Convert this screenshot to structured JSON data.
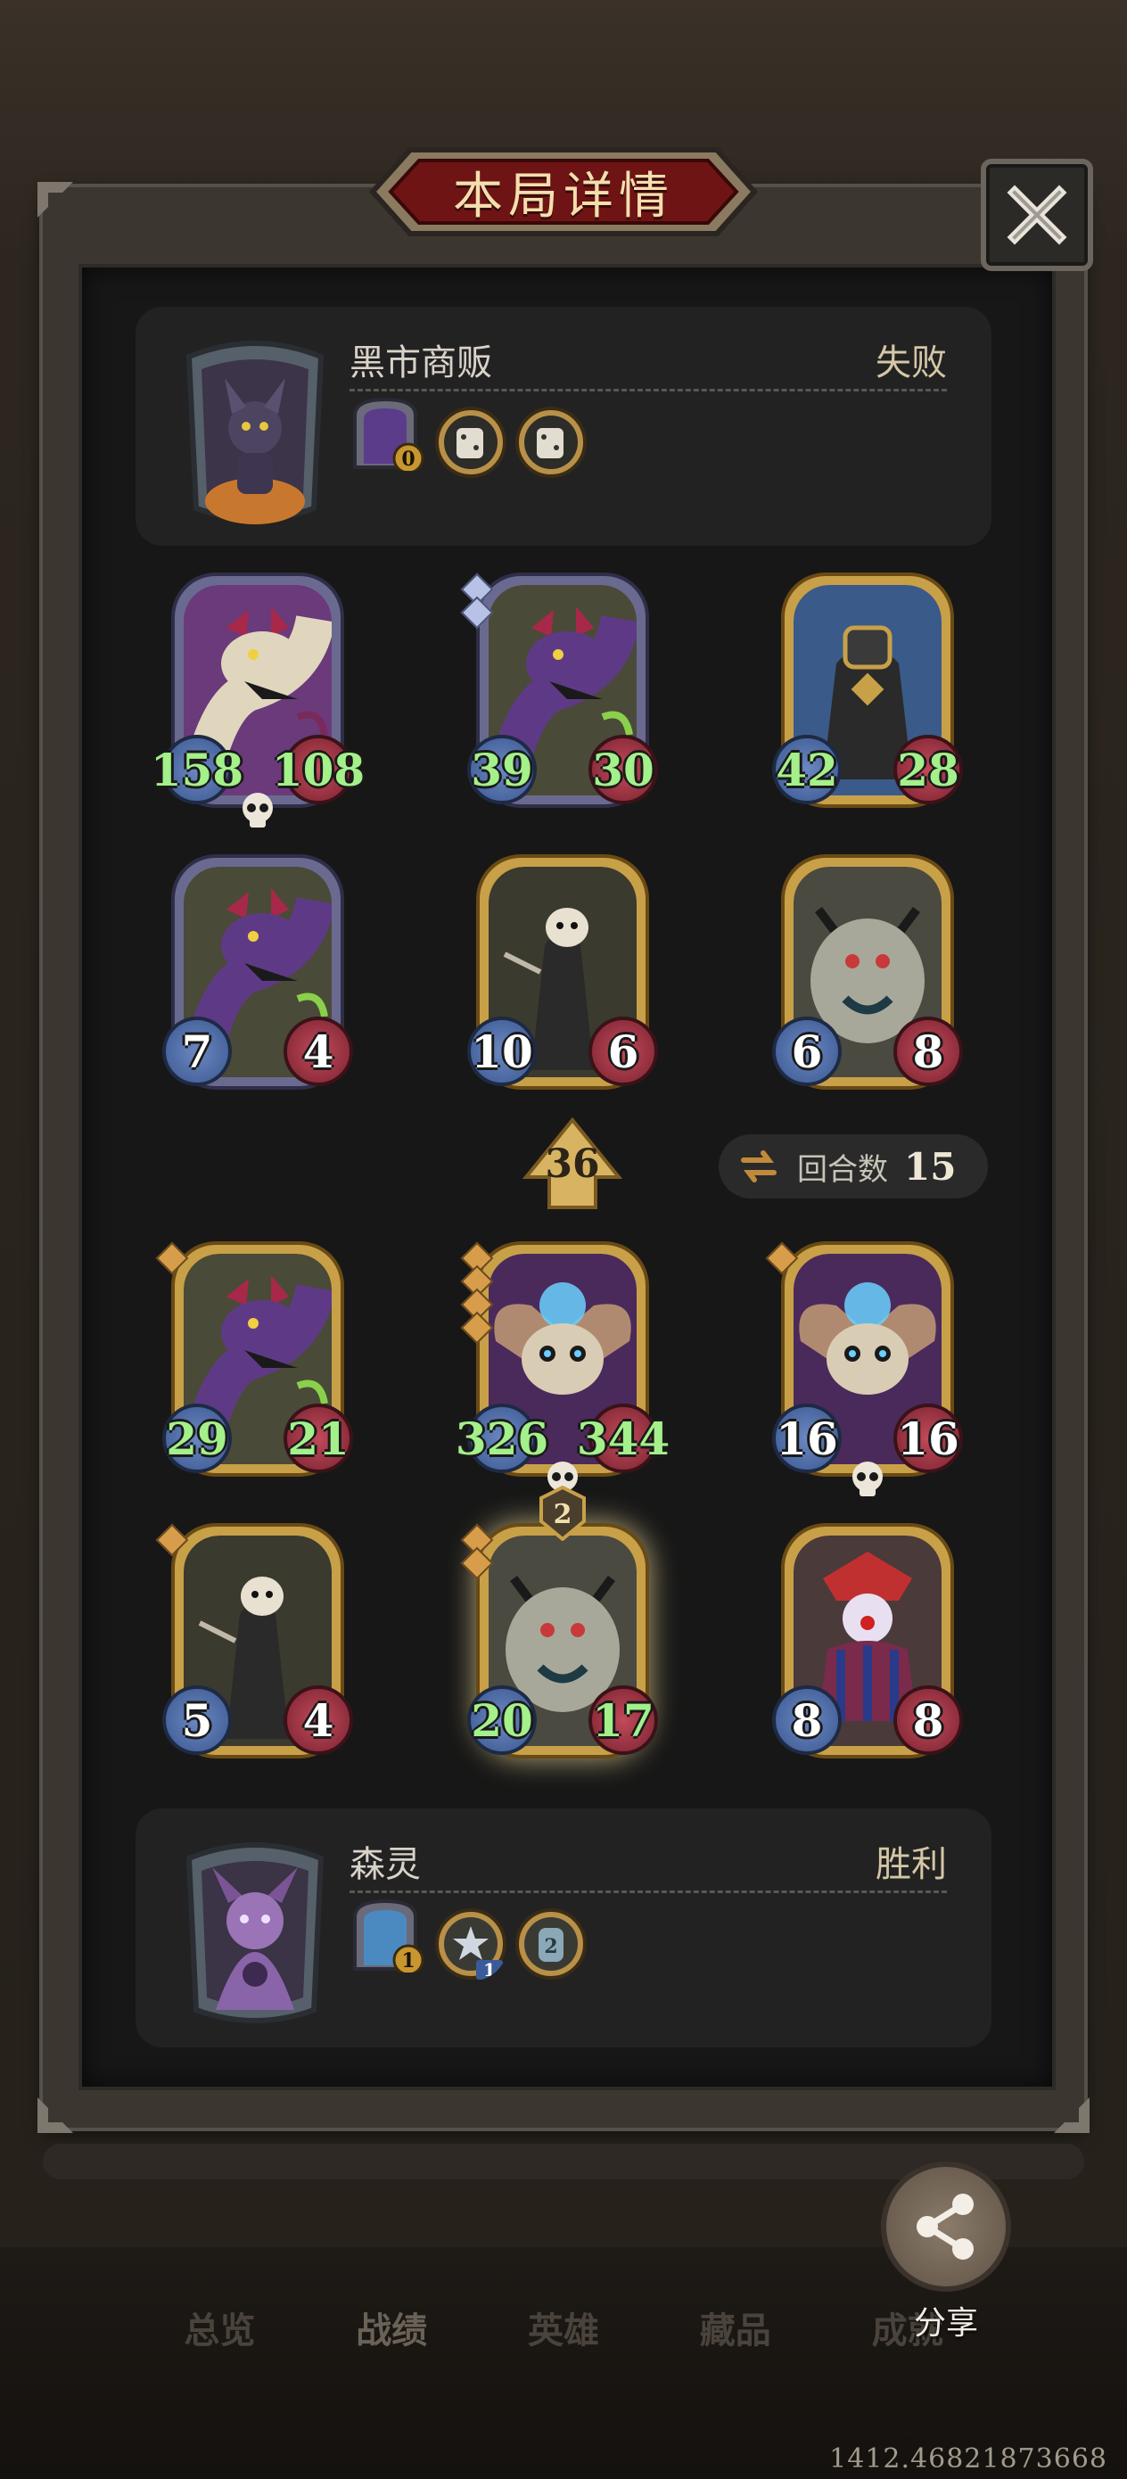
{
  "title": "本局详情",
  "opponent": {
    "name": "黑市商贩",
    "result": "失败",
    "item_badge": "0"
  },
  "player": {
    "name": "森灵",
    "result": "胜利",
    "item_badge": "1",
    "trinket_badge": "1",
    "trinket2_badge": "2"
  },
  "opponent_board": [
    {
      "atk": "158",
      "hp": "108",
      "art": "bone-dragon"
    },
    {
      "atk": "39",
      "hp": "30",
      "art": "purple-dragon"
    },
    {
      "atk": "42",
      "hp": "28",
      "art": "armored-knight"
    },
    {
      "atk": "7",
      "hp": "4",
      "art": "purple-dragon"
    },
    {
      "atk": "10",
      "hp": "6",
      "art": "skull-necromancer"
    },
    {
      "atk": "6",
      "hp": "8",
      "art": "gargoyle-beast"
    }
  ],
  "player_board": [
    {
      "atk": "29",
      "hp": "21",
      "art": "purple-dragon"
    },
    {
      "atk": "326",
      "hp": "344",
      "art": "skull-bat"
    },
    {
      "atk": "16",
      "hp": "16",
      "art": "skull-bat"
    },
    {
      "atk": "5",
      "hp": "4",
      "art": "skull-necromancer"
    },
    {
      "atk": "20",
      "hp": "17",
      "art": "gargoyle-beast",
      "badge": "2"
    },
    {
      "atk": "8",
      "hp": "8",
      "art": "clown"
    }
  ],
  "damage_value": "36",
  "turns": {
    "label": "回合数",
    "value": "15"
  },
  "nav": {
    "overview": "总览",
    "record": "战绩",
    "heroes": "英雄",
    "collection": "藏品",
    "achievement": "成就"
  },
  "share_label": "分享",
  "coords": "1412.46821873668",
  "colors": {
    "gold": "#c8a048",
    "buff_green": "#a4f08a",
    "attack_blue": "#4a6aa8",
    "health_red": "#9a2e3e"
  }
}
